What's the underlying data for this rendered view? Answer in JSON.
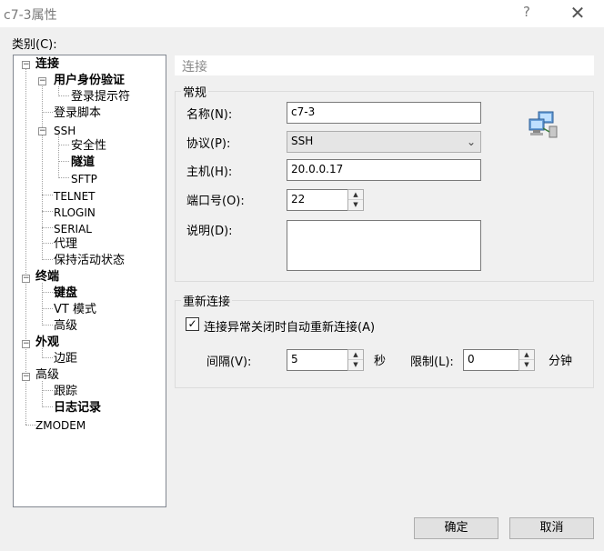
{
  "window": {
    "title": "c7-3属性",
    "help_glyph": "?",
    "close_glyph": "✕"
  },
  "category_label": "类别(C):",
  "tree": {
    "connection": "连接",
    "user_auth": "用户身份验证",
    "login_prompt": "登录提示符",
    "login_script": "登录脚本",
    "ssh": "SSH",
    "security": "安全性",
    "tunnel": "隧道",
    "sftp": "SFTP",
    "telnet": "TELNET",
    "rlogin": "RLOGIN",
    "serial": "SERIAL",
    "proxy": "代理",
    "keepalive": "保持活动状态",
    "terminal": "终端",
    "keyboard": "键盘",
    "vt_mode": "VT 模式",
    "terminal_advanced": "高级",
    "appearance": "外观",
    "margin": "边距",
    "advanced": "高级",
    "trace": "跟踪",
    "logging": "日志记录",
    "zmodem": "ZMODEM"
  },
  "panel": {
    "header": "连接",
    "general": {
      "title": "常规",
      "name_label": "名称(N):",
      "name_value": "c7-3",
      "protocol_label": "协议(P):",
      "protocol_value": "SSH",
      "host_label": "主机(H):",
      "host_value": "20.0.0.17",
      "port_label": "端口号(O):",
      "port_value": "22",
      "desc_label": "说明(D):",
      "desc_value": ""
    },
    "reconnect": {
      "title": "重新连接",
      "auto_reconnect_label": "连接异常关闭时自动重新连接(A)",
      "auto_reconnect_checked": true,
      "interval_label": "间隔(V):",
      "interval_value": "5",
      "seconds_unit": "秒",
      "limit_label": "限制(L):",
      "limit_value": "0",
      "minutes_unit": "分钟"
    }
  },
  "buttons": {
    "ok": "确定",
    "cancel": "取消"
  },
  "colors": {
    "window_bg": "#f0f0f0",
    "panel_header_text": "#8a8a8a",
    "tree_border": "#828790"
  },
  "icons": {
    "toggle": "minus-box",
    "network": "network-computers-icon",
    "spin_up": "▲",
    "spin_down": "▼",
    "select_arrow": "⌄",
    "check": "✓"
  }
}
